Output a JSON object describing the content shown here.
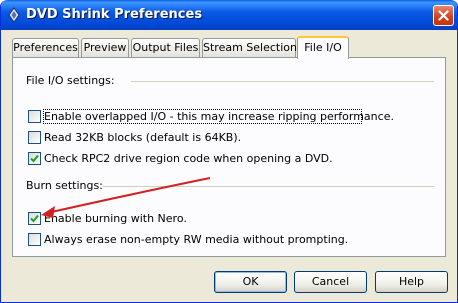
{
  "window": {
    "title": "DVD Shrink Preferences",
    "close_icon": "close-x-icon",
    "app_icon": "dvd-shrink-app-icon",
    "titlebar_color": "#0a5ae6"
  },
  "tabs": [
    {
      "label": "Preferences",
      "active": false
    },
    {
      "label": "Preview",
      "active": false
    },
    {
      "label": "Output Files",
      "active": false
    },
    {
      "label": "Stream Selections",
      "active": false
    },
    {
      "label": "File I/O",
      "active": true
    }
  ],
  "file_io": {
    "section_label": "File I/O settings:",
    "options": [
      {
        "label": "Enable overlapped I/O - this may increase ripping performance.",
        "checked": false,
        "focused": true
      },
      {
        "label": "Read 32KB blocks (default is 64KB).",
        "checked": false
      },
      {
        "label": "Check RPC2 drive region code when opening a DVD.",
        "checked": true
      }
    ]
  },
  "burn": {
    "section_label": "Burn settings:",
    "options": [
      {
        "label": "Enable burning with Nero.",
        "checked": true
      },
      {
        "label": "Always erase non-empty RW media without prompting.",
        "checked": false
      }
    ]
  },
  "annotation": {
    "type": "arrow",
    "color": "#d42020",
    "points_to": "Enable burning with Nero."
  },
  "buttons": {
    "ok": "OK",
    "cancel": "Cancel",
    "help": "Help"
  }
}
